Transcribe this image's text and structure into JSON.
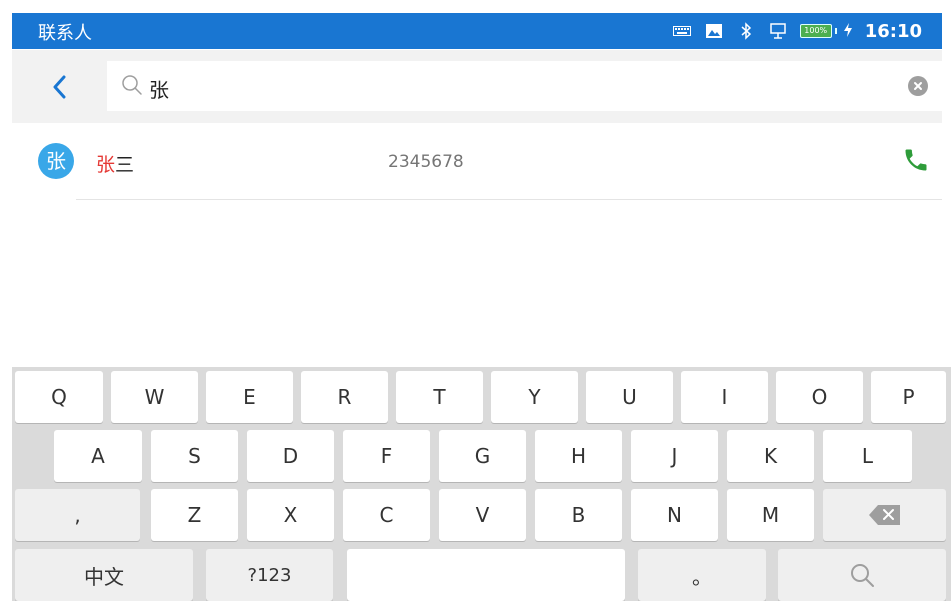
{
  "statusbar": {
    "title": "联系人",
    "battery_text": "100%",
    "time": "16:10",
    "icons": [
      "keyboard-icon",
      "image-icon",
      "bluetooth-icon",
      "network-icon",
      "battery-icon",
      "charging-icon"
    ]
  },
  "search": {
    "query": "张"
  },
  "results": [
    {
      "avatar": "张",
      "name_highlight": "张",
      "name_rest": "三",
      "number": "2345678"
    }
  ],
  "keyboard": {
    "row1": [
      "Q",
      "W",
      "E",
      "R",
      "T",
      "Y",
      "U",
      "I",
      "O",
      "P"
    ],
    "row2": [
      "A",
      "S",
      "D",
      "F",
      "G",
      "H",
      "J",
      "K",
      "L"
    ],
    "row3": [
      ",",
      "Z",
      "X",
      "C",
      "V",
      "B",
      "N",
      "M"
    ],
    "row4": {
      "lang": "中文",
      "symbols": "?123",
      "period": "。"
    }
  },
  "colors": {
    "statusbar": "#1976d2",
    "accent": "#1976d2",
    "highlight": "#e53935",
    "call": "#2e9c3a",
    "avatar": "#39a7e8"
  }
}
